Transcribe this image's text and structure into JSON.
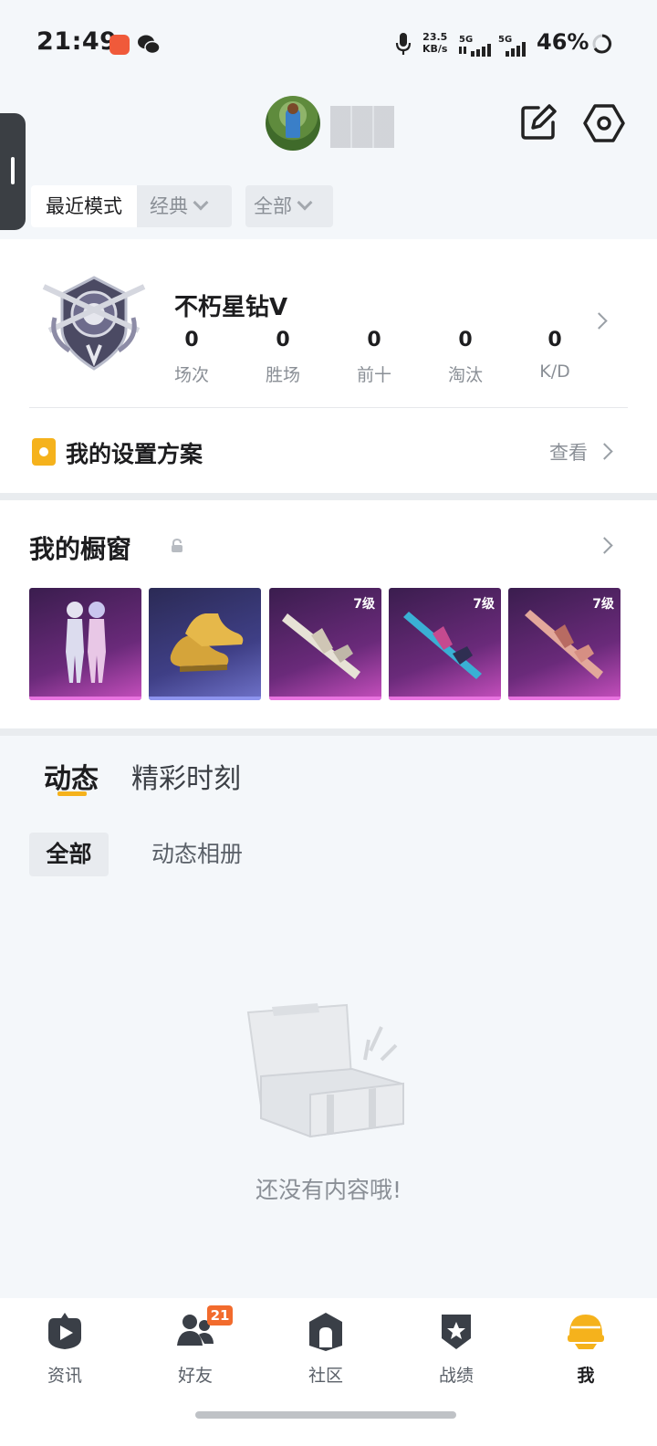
{
  "status_bar": {
    "time": "21:49",
    "net_speed_value": "23.5",
    "net_speed_unit": "KB/s",
    "signal1": "5G",
    "signal2": "5G",
    "battery": "46%"
  },
  "filters": {
    "recent": "最近模式",
    "classic": "经典",
    "all": "全部"
  },
  "rank": {
    "title": "不朽星钻Ⅴ",
    "stats": [
      {
        "value": "0",
        "label": "场次"
      },
      {
        "value": "0",
        "label": "胜场"
      },
      {
        "value": "0",
        "label": "前十"
      },
      {
        "value": "0",
        "label": "淘汰"
      },
      {
        "value": "0",
        "label": "K/D"
      }
    ]
  },
  "settings_plan": {
    "label": "我的设置方案",
    "view": "查看"
  },
  "showcase": {
    "title": "我的橱窗",
    "items": [
      {
        "icon": "outfit-pair-icon",
        "level": "",
        "rarity_color": "#c64fbd"
      },
      {
        "icon": "golden-shoes-icon",
        "level": "",
        "rarity_color": "#6f72c9"
      },
      {
        "icon": "rifle-skin-icon",
        "level": "7级",
        "rarity_color": "#c64fbd"
      },
      {
        "icon": "rifle-skin-icon",
        "level": "7级",
        "rarity_color": "#c64fbd"
      },
      {
        "icon": "rifle-skin-icon",
        "level": "7级",
        "rarity_color": "#c64fbd"
      }
    ]
  },
  "feed": {
    "tabs": [
      "动态",
      "精彩时刻"
    ],
    "subtabs": [
      "全部",
      "动态相册"
    ],
    "empty_text": "还没有内容哦!"
  },
  "nav": {
    "items": [
      {
        "label": "资讯",
        "icon": "news-play-icon"
      },
      {
        "label": "好友",
        "icon": "friends-icon"
      },
      {
        "label": "社区",
        "icon": "community-icon"
      },
      {
        "label": "战绩",
        "icon": "record-star-icon"
      },
      {
        "label": "我",
        "icon": "helmet-icon"
      }
    ],
    "friends_badge": "21"
  },
  "colors": {
    "accent": "#f5b21c",
    "badge": "#f26b2d"
  }
}
